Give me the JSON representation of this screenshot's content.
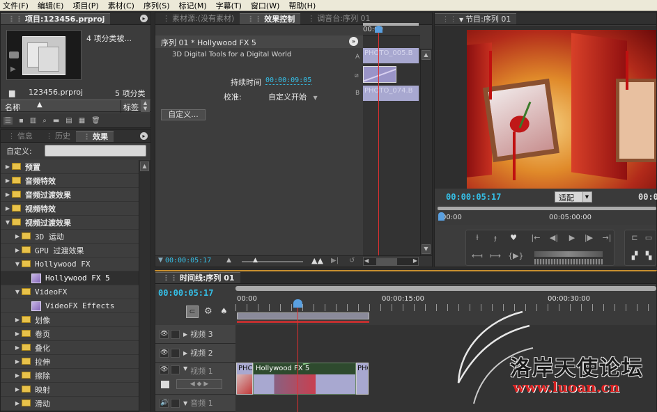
{
  "menu": [
    "文件(F)",
    "编辑(E)",
    "项目(P)",
    "素材(C)",
    "序列(S)",
    "标记(M)",
    "字幕(T)",
    "窗口(W)",
    "帮助(H)"
  ],
  "project": {
    "tab": "项目:123456.prproj",
    "selection_info": "4 项分类被...",
    "file_name": "123456.prproj",
    "item_count": "5 项分类",
    "col_name": "名称",
    "col_label": "标签"
  },
  "effects": {
    "tabs": [
      "信息",
      "历史",
      "效果"
    ],
    "search_label": "自定义:",
    "search_value": "",
    "items": [
      {
        "label": "预置",
        "level": 0,
        "kind": "folder",
        "bold": true,
        "open": false
      },
      {
        "label": "音频特效",
        "level": 0,
        "kind": "folder",
        "bold": true,
        "open": false
      },
      {
        "label": "音频过渡效果",
        "level": 0,
        "kind": "folder",
        "bold": true,
        "open": false
      },
      {
        "label": "视频特效",
        "level": 0,
        "kind": "folder",
        "bold": true,
        "open": false
      },
      {
        "label": "视频过渡效果",
        "level": 0,
        "kind": "folder",
        "bold": true,
        "open": true
      },
      {
        "label": "3D 运动",
        "level": 1,
        "kind": "folder",
        "open": false
      },
      {
        "label": "GPU 过渡效果",
        "level": 1,
        "kind": "folder",
        "open": false
      },
      {
        "label": "Hollywood FX",
        "level": 1,
        "kind": "folder",
        "open": true
      },
      {
        "label": "Hollywood FX 5",
        "level": 2,
        "kind": "effect",
        "selected": true
      },
      {
        "label": "VideoFX",
        "level": 1,
        "kind": "folder",
        "open": true
      },
      {
        "label": "VideoFX Effects",
        "level": 2,
        "kind": "effect"
      },
      {
        "label": "划像",
        "level": 1,
        "kind": "folder",
        "open": false
      },
      {
        "label": "卷页",
        "level": 1,
        "kind": "folder",
        "open": false
      },
      {
        "label": "叠化",
        "level": 1,
        "kind": "folder",
        "open": false
      },
      {
        "label": "拉伸",
        "level": 1,
        "kind": "folder",
        "open": false
      },
      {
        "label": "擦除",
        "level": 1,
        "kind": "folder",
        "open": false
      },
      {
        "label": "映射",
        "level": 1,
        "kind": "folder",
        "open": false
      },
      {
        "label": "滑动",
        "level": 1,
        "kind": "folder",
        "open": false
      }
    ]
  },
  "effect_controls": {
    "tabs": [
      "素材源:(没有素材)",
      "效果控制",
      "调音台:序列 01"
    ],
    "sequence_title": "序列 01 * Hollywood FX 5",
    "plugin_desc": "3D Digital Tools for a Digital World",
    "duration_label": "持续时间",
    "duration_value": "00:00:09:05",
    "align_label": "校准:",
    "align_value": "自定义开始",
    "custom_button": "自定义...",
    "ruler_start": "00:00",
    "clip_a": "PHOTO_005.B",
    "clip_b": "PHOTO_074.B",
    "track_a": "A",
    "track_b": "B",
    "timecode": "00:00:05:17"
  },
  "program": {
    "tab": "节目:序列 01",
    "timecode": "00:00:05:17",
    "fit": "适配",
    "right_time": "00:0",
    "ruler_start": "00:00",
    "ruler_mid": "00:05:00:00"
  },
  "timeline": {
    "tab": "时间线:序列 01",
    "timecode": "00:00:05:17",
    "ruler": [
      "00:00",
      "00:00:15:00",
      "00:00:30:00"
    ],
    "tracks": [
      "视频 3",
      "视频 2",
      "视频 1",
      "音频 1"
    ],
    "clip_left": "PHC",
    "clip_fx": "Hollywood FX 5",
    "clip_right": "PHC"
  },
  "watermark": {
    "title": "洛岸天使论坛",
    "url": "www.luoan.cn"
  },
  "colors": {
    "accent_timecode": "#35c0e8",
    "playhead": "#e03030"
  }
}
